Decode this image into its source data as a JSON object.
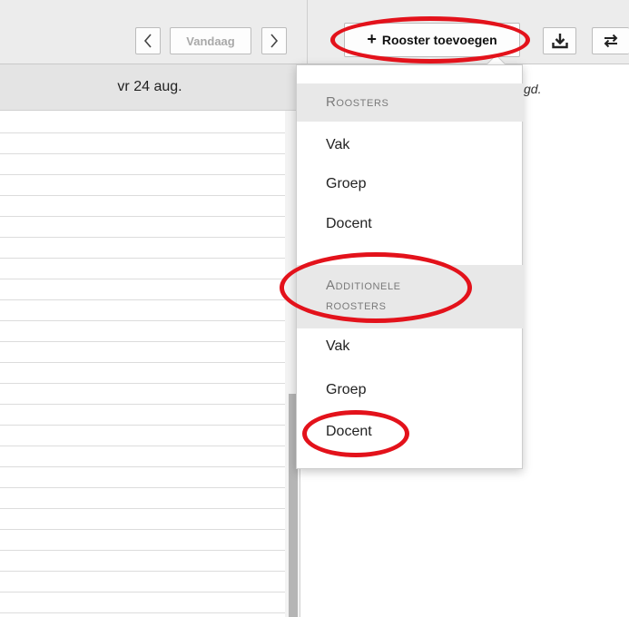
{
  "toolbar": {
    "prev_icon": "chevron-left",
    "today_label": "Vandaag",
    "next_icon": "chevron-right",
    "add_icon": "plus",
    "add_label": "Rooster toevoegen",
    "download_icon": "download",
    "swap_icon": "swap"
  },
  "calendar": {
    "day_header": "vr 24 aug.",
    "right_note": "gd."
  },
  "menu": {
    "section1": {
      "title": "Roosters",
      "items": [
        "Vak",
        "Groep",
        "Docent"
      ]
    },
    "section2": {
      "title_line1": "Additionele",
      "title_line2": "roosters",
      "items": [
        "Vak",
        "Groep",
        "Docent"
      ]
    }
  },
  "colors": {
    "annotation": "#e3121b",
    "toolbar_bg": "#ececec",
    "section_bg": "#e8e8e8"
  }
}
